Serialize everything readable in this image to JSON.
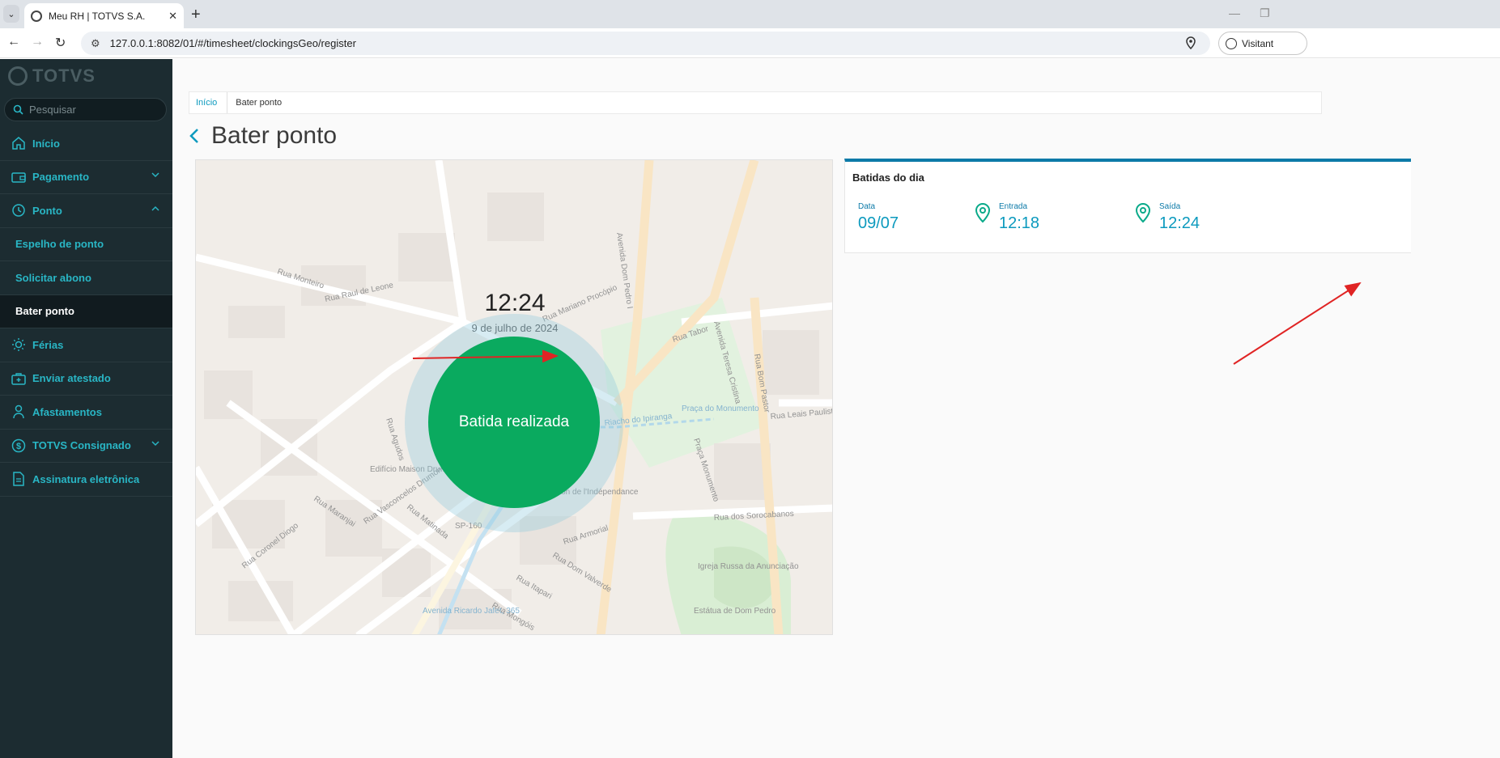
{
  "browser": {
    "tab_title": "Meu RH | TOTVS S.A.",
    "url": "127.0.0.1:8082/01/#/timesheet/clockingsGeo/register",
    "profile_label": "Visitant"
  },
  "sidebar": {
    "logo": "TOTVS",
    "search_placeholder": "Pesquisar",
    "items": [
      {
        "label": "Início",
        "icon": "home-icon"
      },
      {
        "label": "Pagamento",
        "icon": "wallet-icon"
      },
      {
        "label": "Ponto",
        "icon": "clock-icon"
      },
      {
        "label": "Espelho de ponto"
      },
      {
        "label": "Solicitar abono"
      },
      {
        "label": "Bater ponto"
      },
      {
        "label": "Férias",
        "icon": "sun-icon"
      },
      {
        "label": "Enviar atestado",
        "icon": "medical-kit-icon"
      },
      {
        "label": "Afastamentos",
        "icon": "person-icon"
      },
      {
        "label": "TOTVS Consignado",
        "icon": "dollar-icon"
      },
      {
        "label": "Assinatura eletrônica",
        "icon": "document-icon"
      }
    ]
  },
  "breadcrumb": {
    "home": "Início",
    "current": "Bater ponto"
  },
  "page": {
    "title": "Bater ponto"
  },
  "clock": {
    "time": "12:24",
    "date": "9 de julho de 2024",
    "button": "Batida realizada"
  },
  "day_card": {
    "title": "Batidas do dia",
    "data_label": "Data",
    "data_value": "09/07",
    "entrada_label": "Entrada",
    "entrada_value": "12:18",
    "saida_label": "Saída",
    "saida_value": "12:24"
  },
  "map_labels": {
    "r1": "Rua Raul de Leone",
    "r2": "Rua Monteiro",
    "r3": "Rua Mariano Procópio",
    "r4": "Rua Tabor",
    "r5": "Rua Leais Paulista",
    "r6": "Rua dos Sorocabanos",
    "r7": "Rua Armorial",
    "r8": "Rua Dom Valverde",
    "r9": "Rua Maranjai",
    "r10": "Rua Agudos",
    "r11": "Praça Monumento",
    "r12": "Rua Bom Pastor",
    "r13": "Igreja Russa da Anunciação",
    "r14": "SP-160",
    "r15": "Riacho do Ipiranga",
    "r16": "Rua Coronel Diogo",
    "r17": "Rua Itapari",
    "r18": "Rua Mongóis",
    "r19": "Edifício Maison Drumond",
    "r20": "Praça do Monumento",
    "r21": "Avenida Teresa Cristina",
    "r22": "Estátua de Dom Pedro",
    "r23": "Avenida Ricardo Jafet, 365",
    "r24": "Rua Matinada",
    "r25": "Rua Vasconcelos Drumond",
    "r26": "Avenida Dom Pedro I",
    "r27": "Maison de l'Indépendance"
  },
  "colors": {
    "sidebar": "#1c2c31",
    "accent": "#29b6c5",
    "success": "#0aaa5f",
    "arrow": "#e02424"
  }
}
